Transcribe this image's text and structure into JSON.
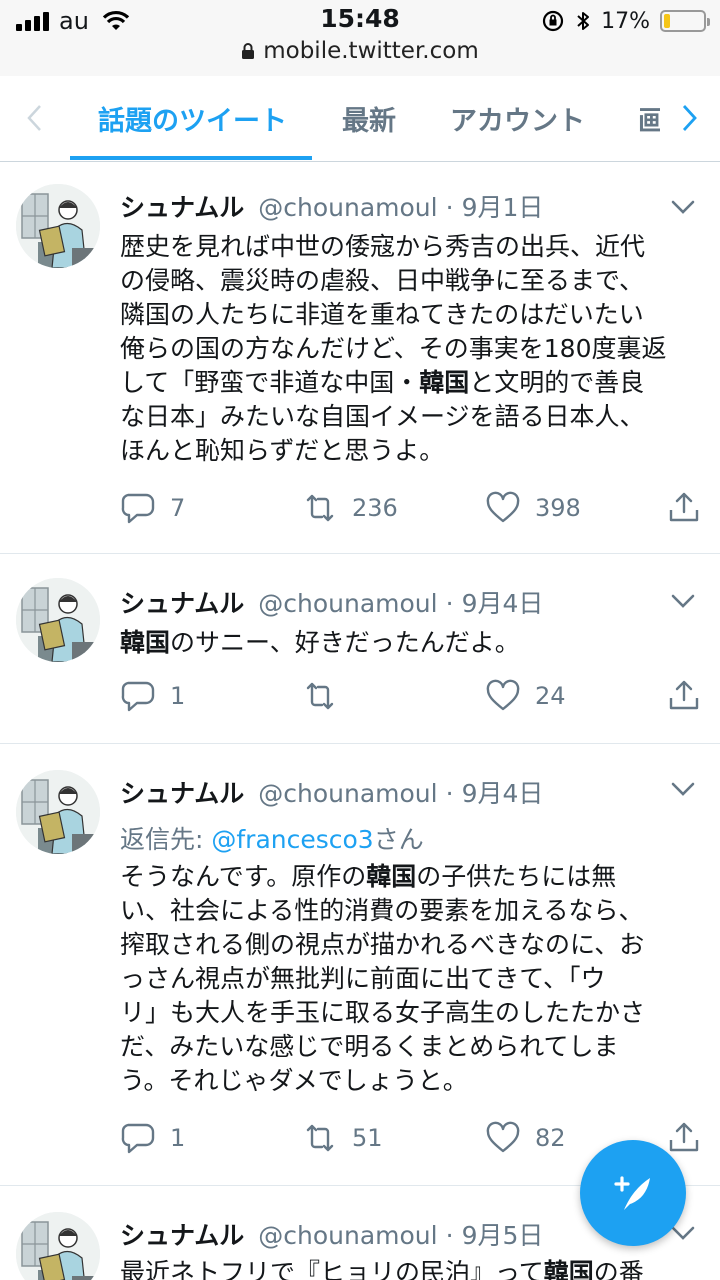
{
  "status_bar": {
    "carrier": "au",
    "time": "15:48",
    "battery_percent": "17%",
    "battery_level": 0.17,
    "url": "mobile.twitter.com"
  },
  "tabs": {
    "items": [
      {
        "label": "話題のツイート",
        "active": true
      },
      {
        "label": "最新",
        "active": false
      },
      {
        "label": "アカウント",
        "active": false
      },
      {
        "label": "画",
        "active": false
      }
    ]
  },
  "tweets": [
    {
      "name": "シュナムル",
      "handle": "@chounamoul",
      "sep": "·",
      "date": "9月1日",
      "text_lines": [
        "歴史を見れば中世の倭寇から秀吉の出兵、近代",
        "の侵略、震災時の虐殺、日中戦争に至るまで、",
        "隣国の人たちに非道を重ねてきたのはだいたい",
        "俺らの国の方なんだけど、その事実を180度裏返",
        "して「野蛮で非道な中国・韓国と文明的で善良",
        "な日本」みたいな自国イメージを語る日本人、",
        "ほんと恥知らずだと思うよ。"
      ],
      "replies": "7",
      "retweets": "236",
      "likes": "398"
    },
    {
      "name": "シュナムル",
      "handle": "@chounamoul",
      "sep": "·",
      "date": "9月4日",
      "text_lines": [
        "韓国のサニー、好きだったんだよ。"
      ],
      "replies": "1",
      "retweets": "",
      "likes": "24"
    },
    {
      "name": "シュナムル",
      "handle": "@chounamoul",
      "sep": "·",
      "date": "9月4日",
      "reply_label": "返信先: ",
      "reply_mention": "@francesco3",
      "reply_suffix": "さん",
      "text_lines": [
        "そうなんです。原作の韓国の子供たちには無",
        "い、社会による性的消費の要素を加えるなら、",
        "搾取される側の視点が描かれるべきなのに、お",
        "っさん視点が無批判に前面に出てきて、「ウ",
        "リ」も大人を手玉に取る女子高生のしたたかさ",
        "だ、みたいな感じで明るくまとめられてしま",
        "う。それじゃダメでしょうと。"
      ],
      "replies": "1",
      "retweets": "51",
      "likes": "82"
    },
    {
      "name": "シュナムル",
      "handle": "@chounamoul",
      "sep": "·",
      "date": "9月5日",
      "text_lines": [
        "最近ネトフリで『ヒョリの民泊』って韓国の番"
      ]
    }
  ],
  "icons": {
    "reply": "reply-icon",
    "retweet": "retweet-icon",
    "like": "heart-icon",
    "share": "share-icon",
    "compose": "compose-tweet-icon"
  },
  "colors": {
    "accent": "#1da1f2",
    "muted": "#657786",
    "text": "#14171a"
  }
}
